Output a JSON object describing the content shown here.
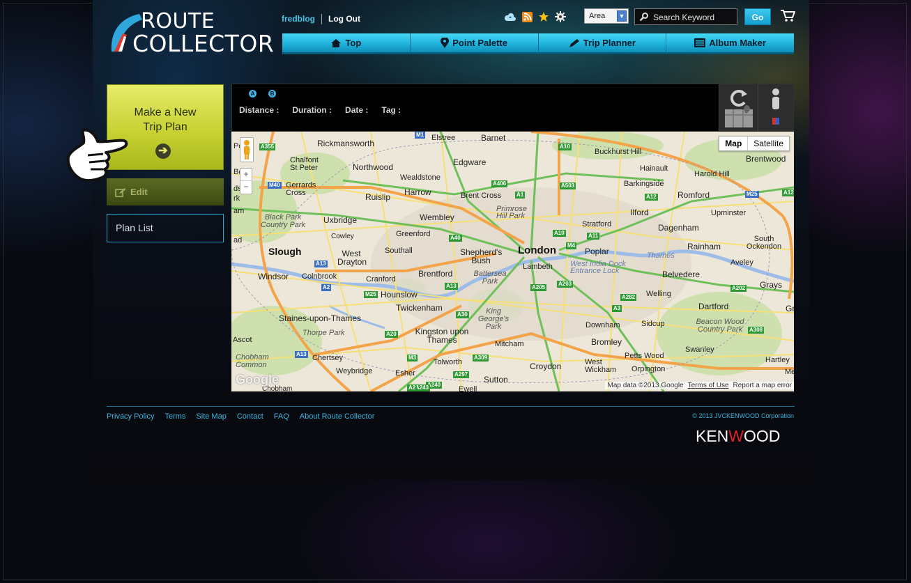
{
  "logo": {
    "line1": "ROUTE",
    "line2": "COLLECTOR"
  },
  "user": {
    "name": "fredblog",
    "logout": "Log Out"
  },
  "tools": {
    "icons": [
      "cloud-icon",
      "rss-icon",
      "star-icon",
      "gear-icon"
    ],
    "area_label": "Area",
    "search_placeholder": "Search Keyword",
    "go_label": "Go",
    "accent": "#1fb3dd"
  },
  "nav": {
    "items": [
      {
        "label": "Top",
        "icon": "home-icon"
      },
      {
        "label": "Point Palette",
        "icon": "map-pin-icon"
      },
      {
        "label": "Trip Planner",
        "icon": "pencil-icon"
      },
      {
        "label": "Album Maker",
        "icon": "album-icon"
      }
    ]
  },
  "sidebar": {
    "new_plan_line1": "Make a New",
    "new_plan_line2": "Trip Plan",
    "edit_label": "Edit",
    "plan_list_label": "Plan List",
    "new_plan_color": "#c8d232"
  },
  "route_info": {
    "badge_a": "A",
    "badge_b": "B",
    "distance_label": "Distance :",
    "duration_label": "Duration :",
    "date_label": "Date :",
    "tag_label": "Tag :"
  },
  "map": {
    "type_map": "Map",
    "type_satellite": "Satellite",
    "attribution": "Map data ©2013 Google",
    "terms": "Terms of Use",
    "report": "Report a map error",
    "watermark": "Google",
    "places": [
      "Rickmansworth",
      "Barnet",
      "Elstree",
      "Buckhurst Hill",
      "Brentwood",
      "Chalfont St Peter",
      "Northwood",
      "Edgware",
      "Hainault",
      "Harold Hill",
      "Gerrards Cross",
      "Wealdstone",
      "Barkingside",
      "Ruislip",
      "Harrow",
      "Brent Cross",
      "Romford",
      "Primrose Hill Park",
      "Ilford",
      "Upminster",
      "Black Park Country Park",
      "Uxbridge",
      "Wembley",
      "Stratford",
      "Dagenham",
      "Cowley",
      "Greenford",
      "South Ockendon",
      "Slough",
      "West Drayton",
      "Southall",
      "Shepherd's Bush",
      "London",
      "Poplar",
      "Rainham",
      "Aveley",
      "Lambeth",
      "West India Dock Entrance Lock",
      "Thames",
      "Windsor",
      "Colnbrook",
      "Cranford",
      "Brentford",
      "Battersea Park",
      "Belvedere",
      "Grays",
      "Hounslow",
      "Welling",
      "Twickenham",
      "King George's Park",
      "Dartford",
      "Gray",
      "Staines-upon-Thames",
      "Downham",
      "Sidcup",
      "Beacon Wood Country Park",
      "Thorpe Park",
      "Kingston upon Thames",
      "Bromley",
      "Ascot",
      "Mitcham",
      "Swanley",
      "Chertsey",
      "Petts Wood",
      "Chobham Common",
      "Tolworth",
      "Croydon",
      "West Wickham",
      "Hartley",
      "Weybridge",
      "Esher",
      "Orpington",
      "Meop",
      "Sutton",
      "Ewell",
      "Chobham",
      "Pe",
      "Be",
      "rk",
      "ds",
      "am",
      "ad"
    ],
    "roads": [
      "A355",
      "M1",
      "A10",
      "M40",
      "A406",
      "A503",
      "A1",
      "A12",
      "M25",
      "A12",
      "A40",
      "A10",
      "A11",
      "A13",
      "M4",
      "A13",
      "A205",
      "A203",
      "A202",
      "A282",
      "A2",
      "M25",
      "A30",
      "A3",
      "A20",
      "A308",
      "A13",
      "M3",
      "A309",
      "A297",
      "A240",
      "A243",
      "A2"
    ]
  },
  "footer": {
    "links": [
      "Privacy Policy",
      "Terms",
      "Site Map",
      "Contact",
      "FAQ",
      "About Route Collector"
    ],
    "copyright": "© 2013 JVCKENWOOD Corporation",
    "brand_a": "KEN",
    "brand_v": "W",
    "brand_b": "OOD"
  }
}
